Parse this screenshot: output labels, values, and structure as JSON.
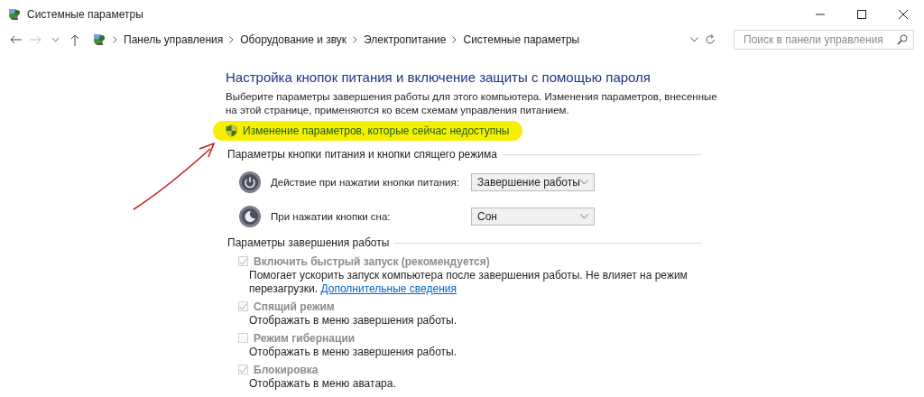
{
  "window": {
    "title": "Системные параметры"
  },
  "nav": {
    "breadcrumb": [
      "Панель управления",
      "Оборудование и звук",
      "Электропитание",
      "Системные параметры"
    ],
    "search": {
      "placeholder": "Поиск в панели управления"
    }
  },
  "heading": "Настройка кнопок питания и включение защиты с помощью пароля",
  "description": "Выберите параметры завершения работы для этого компьютера. Изменения параметров, внесенные на этой странице, применяются ко всем схемам управления питанием.",
  "admin_link": "Изменение параметров, которые сейчас недоступны",
  "button_section": {
    "title": "Параметры кнопки питания и кнопки спящего режима",
    "rows": [
      {
        "kind": "power",
        "label": "Действие при нажатии кнопки питания:",
        "value": "Завершение работы"
      },
      {
        "kind": "sleep",
        "label": "При нажатии кнопки сна:",
        "value": "Сон"
      }
    ]
  },
  "shutdown_section": {
    "title": "Параметры завершения работы",
    "options": [
      {
        "label": "Включить быстрый запуск (рекомендуется)",
        "checked": true,
        "disabled": true,
        "description": "Помогает ускорить запуск компьютера после завершения работы. Не влияет на режим перезагрузки.",
        "link": "Дополнительные сведения"
      },
      {
        "label": "Спящий режим",
        "checked": true,
        "disabled": true,
        "description": "Отображать в меню завершения работы."
      },
      {
        "label": "Режим гибернации",
        "checked": false,
        "disabled": true,
        "description": "Отображать в меню завершения работы."
      },
      {
        "label": "Блокировка",
        "checked": true,
        "disabled": true,
        "description": "Отображать в меню аватара."
      }
    ]
  }
}
